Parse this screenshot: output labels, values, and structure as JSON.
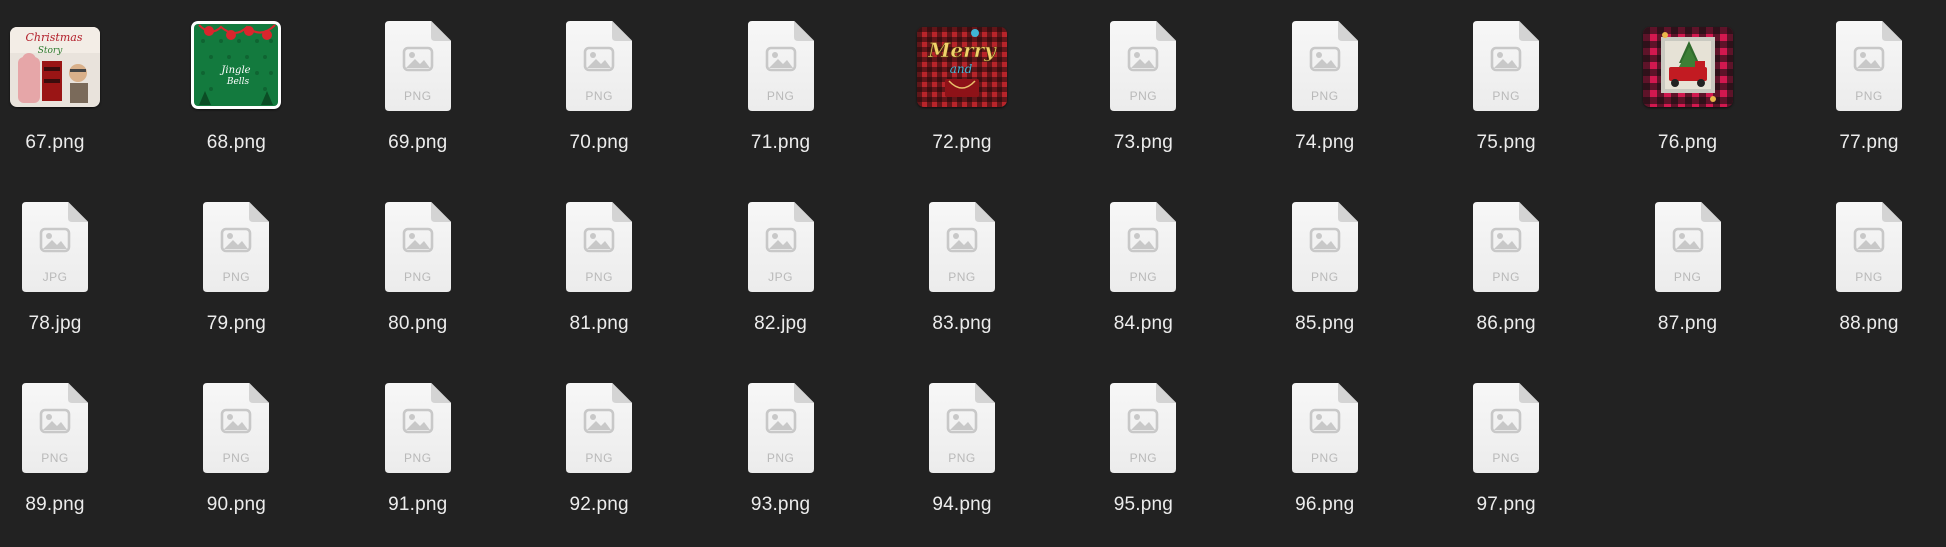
{
  "window": {
    "view": "icon-view",
    "background_color": "#222222"
  },
  "files": [
    {
      "name": "67.png",
      "type": "image",
      "preview": "christmas-story-photo"
    },
    {
      "name": "68.png",
      "type": "image",
      "preview": "jingle-bells-green"
    },
    {
      "name": "69.png",
      "type": "generic",
      "ext": "PNG"
    },
    {
      "name": "70.png",
      "type": "generic",
      "ext": "PNG"
    },
    {
      "name": "71.png",
      "type": "generic",
      "ext": "PNG"
    },
    {
      "name": "72.png",
      "type": "image",
      "preview": "merry-plaid"
    },
    {
      "name": "73.png",
      "type": "generic",
      "ext": "PNG"
    },
    {
      "name": "74.png",
      "type": "generic",
      "ext": "PNG"
    },
    {
      "name": "75.png",
      "type": "generic",
      "ext": "PNG"
    },
    {
      "name": "76.png",
      "type": "image",
      "preview": "red-truck-plaid"
    },
    {
      "name": "77.png",
      "type": "generic",
      "ext": "PNG"
    },
    {
      "name": "78.jpg",
      "type": "generic",
      "ext": "JPG"
    },
    {
      "name": "79.png",
      "type": "generic",
      "ext": "PNG"
    },
    {
      "name": "80.png",
      "type": "generic",
      "ext": "PNG"
    },
    {
      "name": "81.png",
      "type": "generic",
      "ext": "PNG"
    },
    {
      "name": "82.jpg",
      "type": "generic",
      "ext": "JPG"
    },
    {
      "name": "83.png",
      "type": "generic",
      "ext": "PNG"
    },
    {
      "name": "84.png",
      "type": "generic",
      "ext": "PNG"
    },
    {
      "name": "85.png",
      "type": "generic",
      "ext": "PNG"
    },
    {
      "name": "86.png",
      "type": "generic",
      "ext": "PNG"
    },
    {
      "name": "87.png",
      "type": "generic",
      "ext": "PNG"
    },
    {
      "name": "88.png",
      "type": "generic",
      "ext": "PNG"
    },
    {
      "name": "89.png",
      "type": "generic",
      "ext": "PNG"
    },
    {
      "name": "90.png",
      "type": "generic",
      "ext": "PNG"
    },
    {
      "name": "91.png",
      "type": "generic",
      "ext": "PNG"
    },
    {
      "name": "92.png",
      "type": "generic",
      "ext": "PNG"
    },
    {
      "name": "93.png",
      "type": "generic",
      "ext": "PNG"
    },
    {
      "name": "94.png",
      "type": "generic",
      "ext": "PNG"
    },
    {
      "name": "95.png",
      "type": "generic",
      "ext": "PNG"
    },
    {
      "name": "96.png",
      "type": "generic",
      "ext": "PNG"
    },
    {
      "name": "97.png",
      "type": "generic",
      "ext": "PNG"
    }
  ],
  "thumbnails": {
    "christmas-story-photo": {
      "line1": "Christmas",
      "line2": "Story"
    },
    "jingle-bells-green": {
      "line1": "Jingle",
      "line2": "Bells"
    },
    "merry-plaid": {
      "line1": "Merry",
      "line2": "and"
    },
    "red-truck-plaid": {}
  }
}
